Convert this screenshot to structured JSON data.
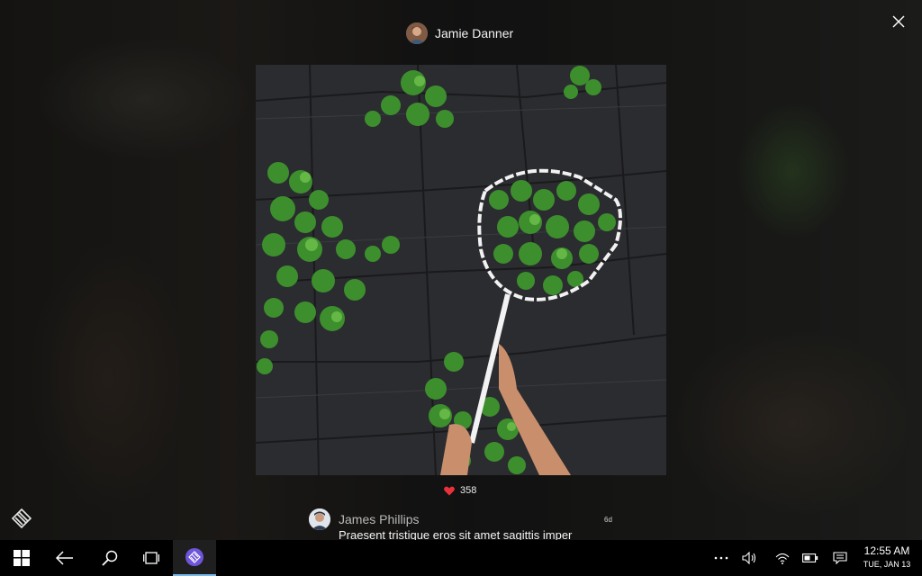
{
  "viewer": {
    "author_name": "Jamie Danner",
    "close_label": "×"
  },
  "photo": {
    "description_icon": "photo-image"
  },
  "stats": {
    "likes_count": "358",
    "heart_color": "#e8313b"
  },
  "comment": {
    "author": "James Phillips",
    "time": "6d",
    "text": "Praesent tristique eros sit amet sagittis imper"
  },
  "taskbar": {
    "active_accent": "#76b9ed",
    "clock_time": "12:55 AM",
    "clock_date": "TUE, JAN 13",
    "icons": [
      "windows-start-icon",
      "back-arrow-icon",
      "search-icon",
      "task-view-icon",
      "app-icon",
      "more-dots-icon",
      "volume-icon",
      "wifi-icon",
      "battery-icon",
      "action-center-icon"
    ]
  }
}
